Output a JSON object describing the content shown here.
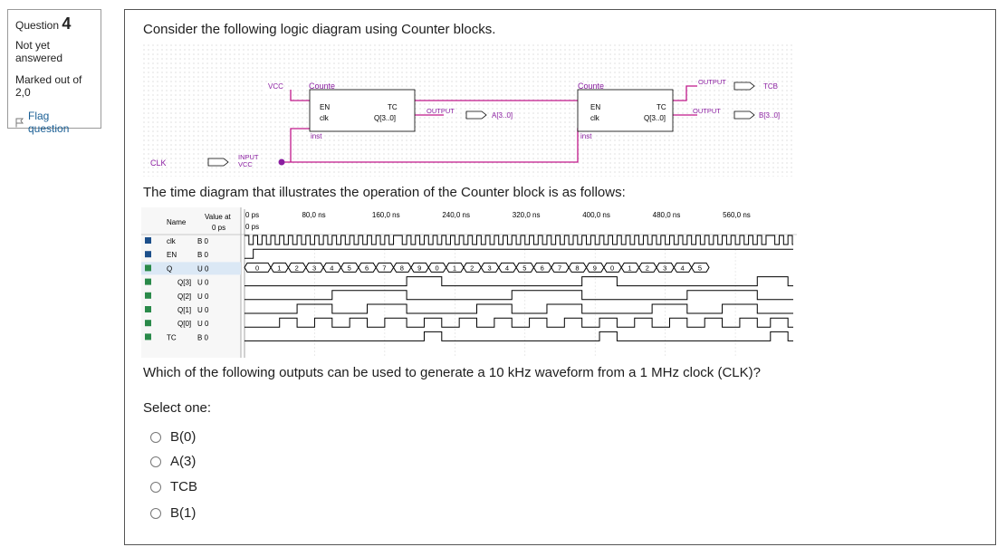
{
  "question": {
    "label": "Question",
    "number": "4",
    "state": "Not yet answered",
    "marks": "Marked out of 2,0",
    "flag_label": "Flag question"
  },
  "content": {
    "intro": "Consider the following logic diagram using Counter blocks.",
    "timing_intro": "The time diagram that illustrates the operation of the Counter block is as follows:",
    "question": "Which of the following outputs can be used to generate a 10 kHz waveform from a 1 MHz clock (CLK)?",
    "select_one": "Select one:",
    "options": [
      "B(0)",
      "A(3)",
      "TCB",
      "B(1)"
    ]
  },
  "diagram": {
    "vcc": "VCC",
    "counter_label": "Counte",
    "en": "EN",
    "clk": "clk",
    "tc": "TC",
    "q": "Q[3..0]",
    "inst1": "inst",
    "inst2": "inst",
    "output": "OUTPUT",
    "input": "INPUT",
    "sig_clk": "CLK",
    "sig_a": "A[3..0]",
    "sig_b": "B[3..0]",
    "sig_tcb": "TCB"
  },
  "timing": {
    "name_header": "Name",
    "value_header_1": "Value at",
    "value_header_2": "0 ps",
    "cursor_top": "0 ps",
    "cursor_sub": "0 ps",
    "time_labels": [
      "80,0 ns",
      "160,0 ns",
      "240,0 ns",
      "320,0 ns",
      "400,0 ns",
      "480,0 ns",
      "560,0 ns"
    ],
    "rows": [
      {
        "name": "clk",
        "value": "B 0"
      },
      {
        "name": "EN",
        "value": "B 0"
      },
      {
        "name": "Q",
        "value": "U 0"
      },
      {
        "name": "Q[3]",
        "value": "U 0"
      },
      {
        "name": "Q[2]",
        "value": "U 0"
      },
      {
        "name": "Q[1]",
        "value": "U 0"
      },
      {
        "name": "Q[0]",
        "value": "U 0"
      },
      {
        "name": "TC",
        "value": "B 0"
      }
    ],
    "q_values": [
      "0",
      "1",
      "2",
      "3",
      "4",
      "5",
      "6",
      "7",
      "8",
      "9",
      "0",
      "1",
      "2",
      "3",
      "4",
      "5",
      "6",
      "7",
      "8",
      "9",
      "0",
      "1",
      "2",
      "3",
      "4",
      "5"
    ]
  },
  "colors": {
    "wire": "#c0188a",
    "label": "#8a1ea0",
    "link": "#1a5f95"
  }
}
